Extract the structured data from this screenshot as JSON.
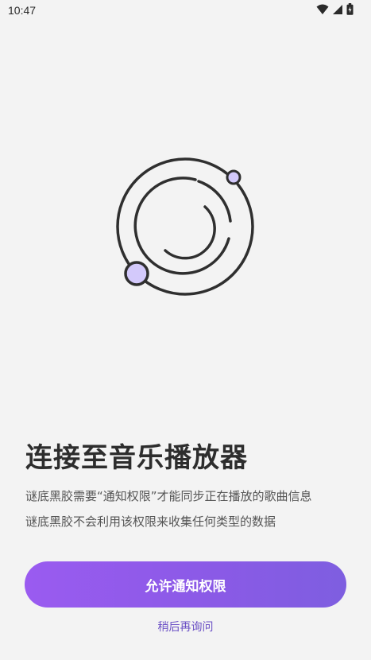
{
  "status_bar": {
    "time": "10:47",
    "icons": [
      "wifi-icon",
      "cellular-signal-icon",
      "battery-charging-icon"
    ]
  },
  "illustration": {
    "icon": "vinyl-orbit-illustration",
    "accent_color": "#d3c9fb",
    "stroke_color": "#2f2f2f"
  },
  "title": "连接至音乐播放器",
  "description": {
    "line1": "谜底黑胶需要“通知权限”才能同步正在播放的歌曲信息",
    "line2": "谜底黑胶不会利用该权限来收集任何类型的数据"
  },
  "actions": {
    "allow_label": "允许通知权限",
    "later_label": "稍后再询问"
  },
  "colors": {
    "background": "#f3f3f3",
    "button_gradient_start": "#9a5bf0",
    "button_gradient_end": "#7e5ee0",
    "link": "#6a4fc5",
    "title": "#2d2d2d"
  }
}
